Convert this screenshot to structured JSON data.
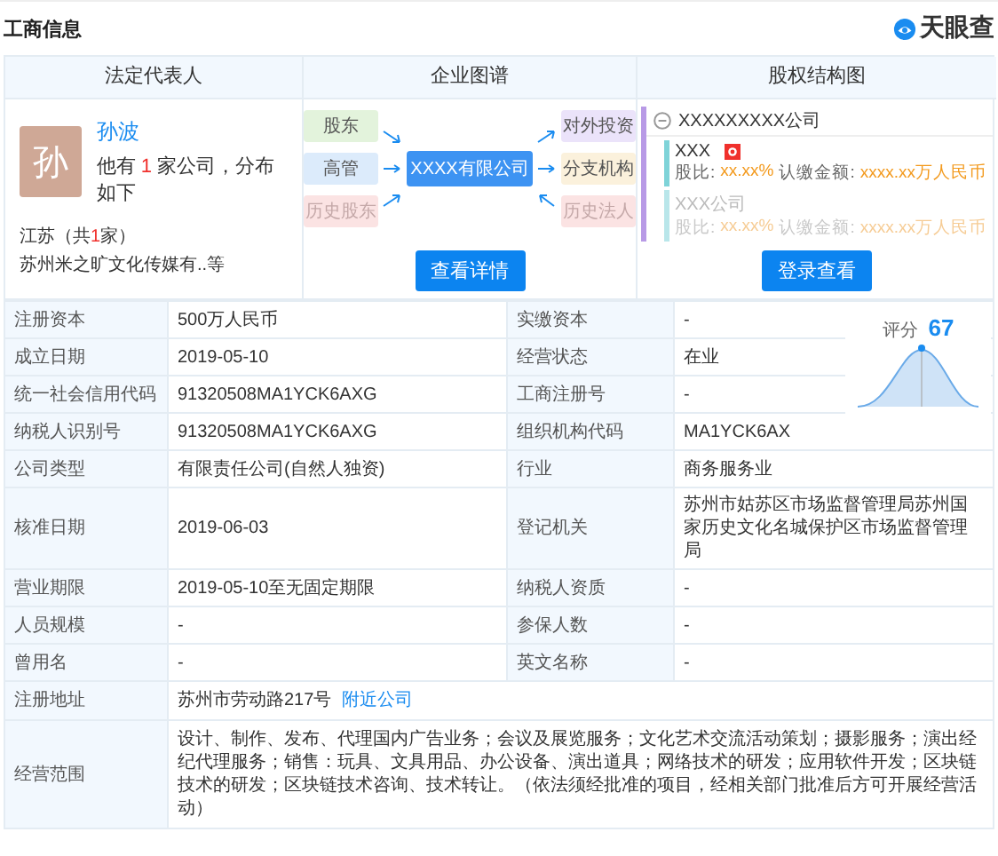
{
  "section_title": "工商信息",
  "brand": {
    "name": "天眼查"
  },
  "panels": {
    "legal_rep": {
      "title": "法定代表人",
      "avatar_char": "孙",
      "name": "孙波",
      "summary": "他有 **1** 家公司，分布如下",
      "region": "江苏（共**1**家）",
      "companies": "苏州米之旷文化传媒有..等"
    },
    "graph": {
      "title": "企业图谱",
      "center": "XXXX有限公司",
      "left_nodes": [
        {
          "text": "股东",
          "color": "#e3f3dc",
          "faded": false
        },
        {
          "text": "高管",
          "color": "#dcebfb",
          "faded": false
        },
        {
          "text": "历史股东",
          "color": "#fbe3e3",
          "faded": true
        }
      ],
      "right_nodes": [
        {
          "text": "对外投资",
          "color": "#ebe3fa",
          "faded": false
        },
        {
          "text": "分支机构",
          "color": "#fbf1dc",
          "faded": false
        },
        {
          "text": "历史法人",
          "color": "#fbe3e3",
          "faded": true
        }
      ],
      "button": "查看详情"
    },
    "equity": {
      "title": "股权结构图",
      "root": "XXXXXXXXX公司",
      "holders": [
        {
          "name": "XXX",
          "badge": true,
          "faded": false,
          "ratio_label": "股比:",
          "ratio": "xx.xx%",
          "amount_label": "认缴金额:",
          "amount": "xxxx.xx万人民币",
          "color": "#7fd3d8"
        },
        {
          "name": "XXX公司",
          "badge": false,
          "faded": true,
          "ratio_label": "股比:",
          "ratio": "xx.xx%",
          "amount_label": "认缴金额:",
          "amount": "xxxx.xx万人民币",
          "color": "#b9e6ea"
        }
      ],
      "button": "登录查看"
    }
  },
  "table": {
    "rows": [
      {
        "cells": [
          {
            "kind": "label",
            "text": "注册资本"
          },
          {
            "kind": "value",
            "text": "500万人民币"
          },
          {
            "kind": "label",
            "text": "实缴资本"
          },
          {
            "kind": "value",
            "text": "-"
          }
        ]
      },
      {
        "cells": [
          {
            "kind": "label",
            "text": "成立日期"
          },
          {
            "kind": "value",
            "text": "2019-05-10"
          },
          {
            "kind": "label",
            "text": "经营状态"
          },
          {
            "kind": "value",
            "text": "在业"
          }
        ]
      },
      {
        "cells": [
          {
            "kind": "label",
            "text": "统一社会信用代码"
          },
          {
            "kind": "value",
            "text": "91320508MA1YCK6AXG"
          },
          {
            "kind": "label",
            "text": "工商注册号"
          },
          {
            "kind": "value",
            "text": "-"
          }
        ]
      },
      {
        "cells": [
          {
            "kind": "label",
            "text": "纳税人识别号"
          },
          {
            "kind": "value",
            "text": "91320508MA1YCK6AXG"
          },
          {
            "kind": "label",
            "text": "组织机构代码"
          },
          {
            "kind": "value",
            "text": "MA1YCK6AX"
          }
        ]
      },
      {
        "cells": [
          {
            "kind": "label",
            "text": "公司类型"
          },
          {
            "kind": "value",
            "text": "有限责任公司(自然人独资)"
          },
          {
            "kind": "label",
            "text": "行业"
          },
          {
            "kind": "value",
            "text": "商务服务业"
          }
        ]
      },
      {
        "cells": [
          {
            "kind": "label",
            "text": "核准日期"
          },
          {
            "kind": "value",
            "text": "2019-06-03"
          },
          {
            "kind": "label",
            "text": "登记机关"
          },
          {
            "kind": "value",
            "text": "苏州市姑苏区市场监督管理局苏州国家历史文化名城保护区市场监督管理局"
          }
        ]
      },
      {
        "cells": [
          {
            "kind": "label",
            "text": "营业期限"
          },
          {
            "kind": "value",
            "text": "2019-05-10至无固定期限"
          },
          {
            "kind": "label",
            "text": "纳税人资质"
          },
          {
            "kind": "value",
            "text": "-"
          }
        ]
      },
      {
        "cells": [
          {
            "kind": "label",
            "text": "人员规模"
          },
          {
            "kind": "value",
            "text": "-"
          },
          {
            "kind": "label",
            "text": "参保人数"
          },
          {
            "kind": "value",
            "text": "-"
          }
        ]
      },
      {
        "cells": [
          {
            "kind": "label",
            "text": "曾用名"
          },
          {
            "kind": "value",
            "text": "-"
          },
          {
            "kind": "label",
            "text": "英文名称"
          },
          {
            "kind": "value",
            "text": "-"
          }
        ]
      },
      {
        "cells": [
          {
            "kind": "label",
            "text": "注册地址"
          },
          {
            "kind": "value",
            "text": "苏州市劳动路217号",
            "link": "附近公司"
          }
        ]
      },
      {
        "cells": [
          {
            "kind": "label",
            "text": "经营范围"
          },
          {
            "kind": "value",
            "text": "设计、制作、发布、代理国内广告业务；会议及展览服务；文化艺术交流活动策划；摄影服务；演出经纪代理服务；销售：玩具、文具用品、办公设备、演出道具；网络技术的研发；应用软件开发；区块链技术的研发；区块链技术咨询、技术转让。（依法须经批准的项目，经相关部门批准后方可开展经营活动）"
          }
        ]
      }
    ]
  },
  "score": {
    "label": "评分",
    "value": "67"
  }
}
